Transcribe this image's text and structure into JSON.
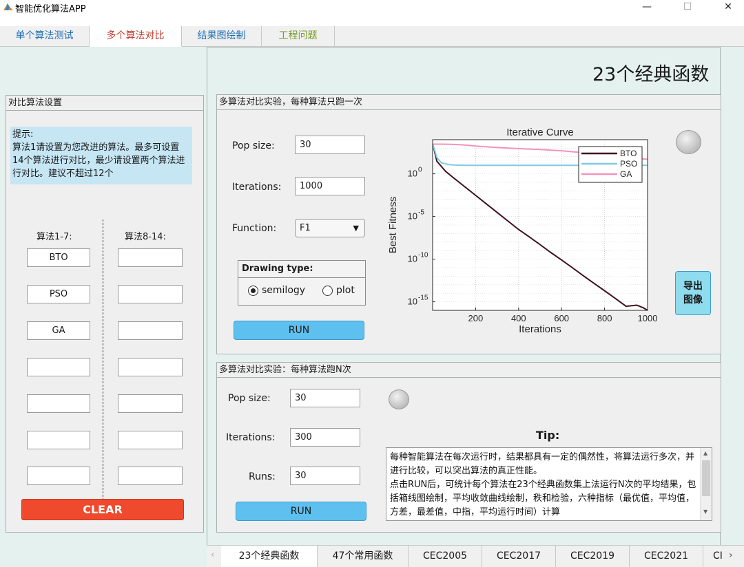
{
  "window": {
    "title": "智能优化算法APP",
    "minimize": "—",
    "maximize": "☐",
    "close": "✕"
  },
  "top_tabs": [
    {
      "label": "单个算法测试",
      "color": "#1f6fb5"
    },
    {
      "label": "多个算法对比",
      "color": "#c0392b"
    },
    {
      "label": "结果图绘制",
      "color": "#1f6fb5"
    },
    {
      "label": "工程问题",
      "color": "#7a9a2a"
    }
  ],
  "main_title": "23个经典函数",
  "left_panel": {
    "title": "对比算法设置",
    "hint": "提示:\n算法1请设置为您改进的算法。最多可设置14个算法进行对比，最少请设置两个算法进行对比。建议不超过12个",
    "col1_header": "算法1-7:",
    "col2_header": "算法8-14:",
    "col1_values": [
      "BTO",
      "PSO",
      "GA",
      "",
      "",
      "",
      ""
    ],
    "col2_values": [
      "",
      "",
      "",
      "",
      "",
      "",
      ""
    ],
    "clear_label": "CLEAR"
  },
  "single_run": {
    "title": "多算法对比实验，每种算法只跑一次",
    "pop_label": "Pop size:",
    "pop_value": "30",
    "iter_label": "Iterations:",
    "iter_value": "1000",
    "func_label": "Function:",
    "func_value": "F1",
    "drawing_type_label": "Drawing type:",
    "option_semilogy": "semilogy",
    "option_plot": "plot",
    "selected_option": "semilogy",
    "run_label": "RUN",
    "export_label": "导出\n图像"
  },
  "multi_run": {
    "title": "多算法对比实验：每种算法跑N次",
    "pop_label": "Pop size:",
    "pop_value": "30",
    "iter_label": "Iterations:",
    "iter_value": "300",
    "runs_label": "Runs:",
    "runs_value": "30",
    "run_label": "RUN",
    "tip_title": "Tip:",
    "tip_text": "每种智能算法在每次运行时，结果都具有一定的偶然性，将算法运行多次，并进行比较，可以突出算法的真正性能。\n点击RUN后，可统计每个算法在23个经典函数集上法运行N次的平均结果，包括箱线图绘制，平均收敛曲线绘制，秩和检验，六种指标（最优值，平均值，方差，最差值，中指，平均运行时间）计算"
  },
  "bottom_tabs": [
    "23个经典函数",
    "47个常用函数",
    "CEC2005",
    "CEC2017",
    "CEC2019",
    "CEC2021",
    "CI"
  ],
  "chart_data": {
    "type": "line",
    "title": "Iterative Curve",
    "xlabel": "Iterations",
    "ylabel": "Best Fitness",
    "y_scale": "log",
    "xlim": [
      0,
      1000
    ],
    "ylim": [
      1e-16,
      10000
    ],
    "x_ticks": [
      200,
      400,
      600,
      800,
      1000
    ],
    "y_ticks": [
      {
        "value": 1,
        "label_base": "10",
        "label_exp": "0"
      },
      {
        "value": 1e-05,
        "label_base": "10",
        "label_exp": "-5"
      },
      {
        "value": 1e-10,
        "label_base": "10",
        "label_exp": "-10"
      },
      {
        "value": 1e-15,
        "label_base": "10",
        "label_exp": "-15"
      }
    ],
    "grid": true,
    "legend_position": "top-right",
    "series": [
      {
        "name": "BTO",
        "color": "#3d0f1a",
        "x": [
          1,
          20,
          60,
          100,
          150,
          200,
          250,
          300,
          350,
          400,
          450,
          500,
          550,
          600,
          650,
          700,
          750,
          800,
          850,
          900,
          950,
          980,
          1000
        ],
        "y": [
          3000,
          30,
          2,
          0.3,
          0.03,
          0.003,
          0.0003,
          3e-05,
          3e-06,
          3e-07,
          4e-08,
          5e-09,
          6e-10,
          8e-11,
          1e-11,
          1.2e-12,
          1.5e-13,
          2e-14,
          2.5e-15,
          3e-16,
          4e-16,
          2e-16,
          1e-16
        ]
      },
      {
        "name": "PSO",
        "color": "#7ccbe6",
        "x": [
          1,
          20,
          40,
          60,
          80,
          100,
          150,
          200,
          300,
          400,
          500,
          600,
          700,
          800,
          900,
          1000
        ],
        "y": [
          3000,
          80,
          20,
          15,
          12,
          11,
          10,
          10,
          10,
          10,
          10,
          10,
          10,
          10,
          10,
          10
        ]
      },
      {
        "name": "GA",
        "color": "#f492bc",
        "x": [
          1,
          50,
          100,
          150,
          200,
          300,
          400,
          500,
          600,
          700,
          800,
          900,
          1000
        ],
        "y": [
          3000,
          3000,
          2800,
          2400,
          1800,
          1200,
          900,
          700,
          500,
          300,
          150,
          80,
          50
        ]
      }
    ]
  }
}
